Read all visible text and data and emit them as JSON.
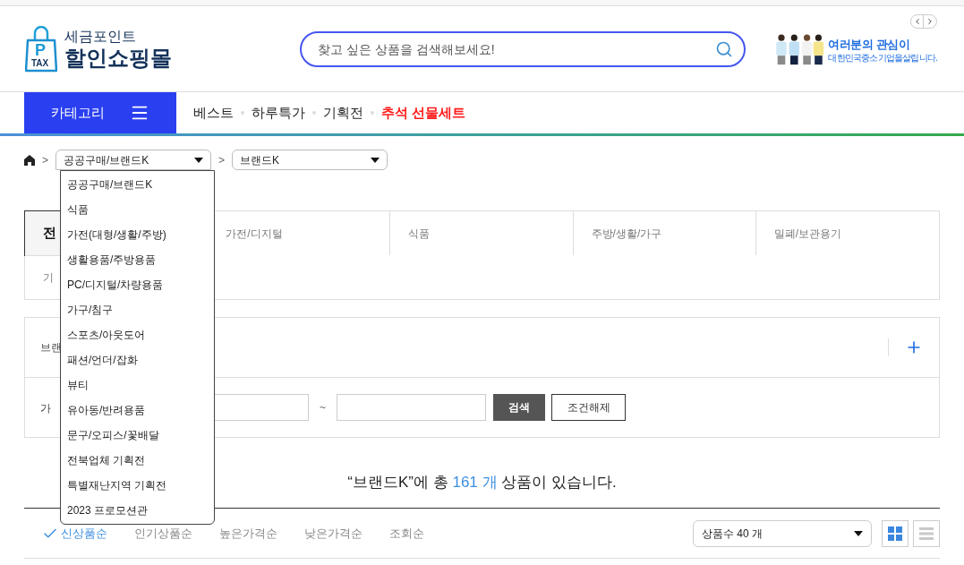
{
  "logo": {
    "badge_letter": "P",
    "badge_text": "TAX",
    "line1": "세금포인트",
    "line2": "할인쇼핑몰"
  },
  "search": {
    "placeholder": "찾고 싶은 상품을 검색해보세요!"
  },
  "banner": {
    "title": "여러분의 관심이",
    "subtitle": "대한민국중소기업을살립니다."
  },
  "category_button": {
    "label": "카테고리"
  },
  "nav": [
    {
      "label": "베스트",
      "highlight": false
    },
    {
      "label": "하루특가",
      "highlight": false
    },
    {
      "label": "기획전",
      "highlight": false
    },
    {
      "label": "추석 선물세트",
      "highlight": true
    }
  ],
  "breadcrumb": {
    "separator": ">",
    "selects": [
      {
        "value": "공공구매/브랜드K",
        "expanded": true
      },
      {
        "value": "브랜드K",
        "expanded": false
      }
    ],
    "options": [
      "공공구매/브랜드K",
      "식품",
      "가전(대형/생활/주방)",
      "생활용품/주방용품",
      "PC/디지털/차량용품",
      "가구/침구",
      "스포츠/아웃도어",
      "패션/언더/잡화",
      "뷰티",
      "유아동/반려용품",
      "문구/오피스/꽃배달",
      "전북업체 기획전",
      "특별재난지역 기획전",
      "2023 프로모션관"
    ]
  },
  "categories": [
    {
      "label": "전",
      "selected": true
    },
    {
      "label": "가전/디지털",
      "selected": false
    },
    {
      "label": "식품",
      "selected": false
    },
    {
      "label": "주방/생활/가구",
      "selected": false
    },
    {
      "label": "밀폐/보관용기",
      "selected": false
    },
    {
      "label": "기",
      "selected": false
    }
  ],
  "filters": {
    "brand_label": "브랜",
    "price_label": "가",
    "range_separator": "~",
    "search_button": "검색",
    "reset_button": "조건해제"
  },
  "result": {
    "prefix": "“브랜드K”에 총",
    "count": "161 개",
    "suffix": "상품이 있습니다."
  },
  "sort_options": [
    {
      "label": "신상품순",
      "selected": true
    },
    {
      "label": "인기상품순",
      "selected": false
    },
    {
      "label": "높은가격순",
      "selected": false
    },
    {
      "label": "낮은가격순",
      "selected": false
    },
    {
      "label": "조회순",
      "selected": false
    }
  ],
  "page_size": {
    "value": "상품수 40 개"
  },
  "view_modes": [
    {
      "kind": "grid",
      "selected": true
    },
    {
      "kind": "list",
      "selected": false
    }
  ]
}
